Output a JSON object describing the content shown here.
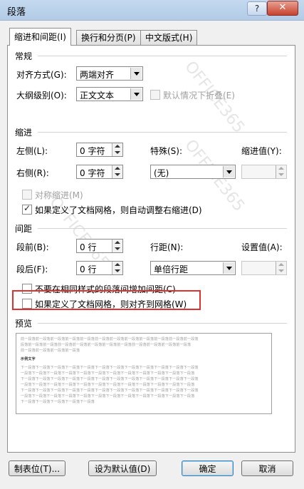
{
  "window": {
    "title": "段落",
    "help": "?",
    "close": "✕"
  },
  "tabs": [
    "缩进和间距(I)",
    "换行和分页(P)",
    "中文版式(H)"
  ],
  "general": {
    "heading": "常规",
    "alignment_label": "对齐方式(G):",
    "alignment_value": "两端对齐",
    "outline_label": "大纲级别(O):",
    "outline_value": "正文文本",
    "collapsed_label": "默认情况下折叠(E)"
  },
  "indent": {
    "heading": "缩进",
    "left_label": "左侧(L):",
    "left_value": "0 字符",
    "right_label": "右侧(R):",
    "right_value": "0 字符",
    "special_label": "特殊(S):",
    "special_value": "(无)",
    "by_label": "缩进值(Y):",
    "mirror_label": "对称缩进(M)",
    "auto_adjust_label": "如果定义了文档网格，则自动调整右缩进(D)"
  },
  "spacing": {
    "heading": "间距",
    "before_label": "段前(B):",
    "before_value": "0 行",
    "after_label": "段后(F):",
    "after_value": "0 行",
    "line_label": "行距(N):",
    "line_value": "单倍行距",
    "at_label": "设置值(A):",
    "no_space_label": "不要在相同样式的段落间增加间距(C)",
    "snap_grid_label": "如果定义了文档网格，则对齐到网格(W)"
  },
  "preview": {
    "heading": "预览",
    "prev_lines": [
      "前一段落前一段落前一段落前一段落前一段落前一段落前一段落前一段落前一段落前一段落前一段落前一段落",
      "段落前一段落前一段落前一段落前一段落前一段落前一段落前一段落前一段落前一段落前一段落前一段落",
      "前一段落前一段落前一段落前一段落"
    ],
    "current_line": "示例文字",
    "next_lines": [
      "下一段落下一段落下一段落下一段落下一段落下一段落下一段落下一段落下一段落下一段落下一段落下一段落",
      "一段落下一段落下一段落下一段落下一段落下一段落下一段落下一段落下一段落下一段落下一段落下一段落",
      "下一段落下一段落下一段落下一段落下一段落下一段落下一段落下一段落下一段落下一段落下一段落下一段落",
      "一段落下一段落下一段落下一段落下一段落下一段落下一段落下一段落下一段落下一段落下一段落下一段落",
      "下一段落下一段落下一段落下一段落下一段落下一段落下一段落下一段落下一段落下一段落下一段落下一段落",
      "一段落下一段落下一段落下一段落下一段落下一段落下一段落下一段落下一段落下一段落下一段落下一段落",
      "下一段落下一段落下一段落下一段落下一段落"
    ]
  },
  "buttons": {
    "tabs": "制表位(T)...",
    "set_default": "设为默认值(D)",
    "ok": "确定",
    "cancel": "取消"
  },
  "watermark": "OFFICE365"
}
